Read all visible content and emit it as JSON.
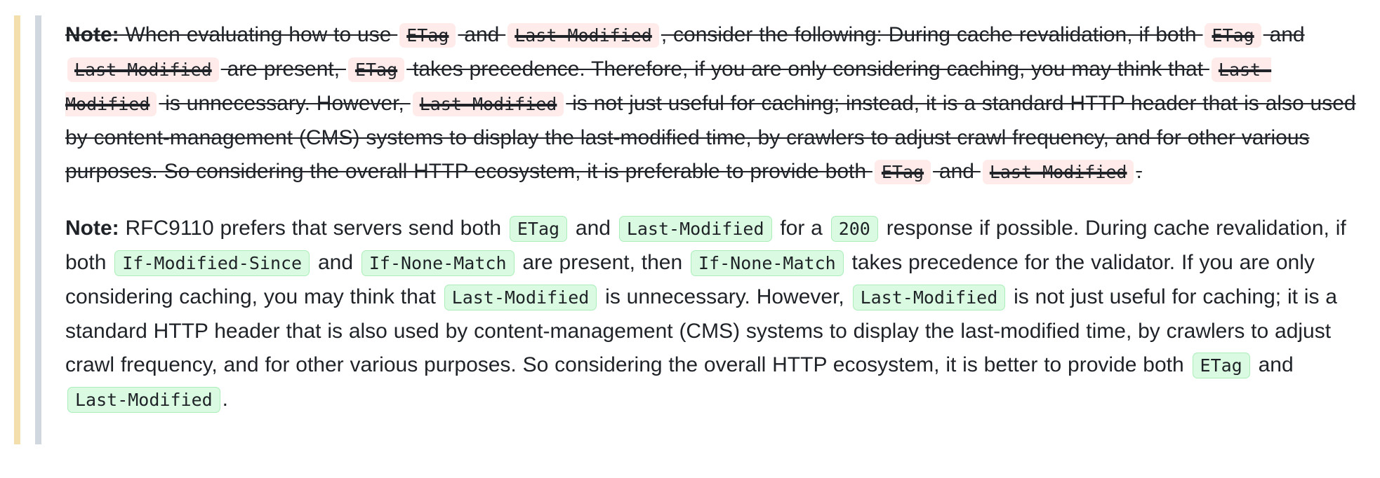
{
  "diff": {
    "removed": {
      "label": "Note:",
      "text": [
        " When evaluating how to use ",
        " and ",
        ", consider the following: During cache revalidation, if both ",
        " and ",
        " are present, ",
        " takes precedence. Therefore, if you are only considering caching, you may think that ",
        " is unnecessary. However, ",
        " is not just useful for caching; instead, it is a standard HTTP header that is also used by content-management (CMS) systems to display the last-modified time, by crawlers to adjust crawl frequency, and for other various purposes. So considering the overall HTTP ecosystem, it is preferable to provide both ",
        " and ",
        "."
      ],
      "code": [
        "ETag",
        "Last-Modified",
        "ETag",
        "Last-Modified",
        "ETag",
        "Last-Modified",
        "Last-Modified",
        "ETag",
        "Last-Modified"
      ]
    },
    "added": {
      "label": "Note:",
      "text": [
        " RFC9110 prefers that servers send both ",
        " and ",
        " for a ",
        " response if possible. During cache revalidation, if both ",
        " and ",
        " are present, then ",
        " takes precedence for the validator. If you are only considering caching, you may think that ",
        " is unnecessary. However, ",
        " is not just useful for caching; it is a standard HTTP header that is also used by content-management (CMS) systems to display the last-modified time, by crawlers to adjust crawl frequency, and for other various purposes. So considering the overall HTTP ecosystem, it is better to provide both ",
        " and ",
        "."
      ],
      "code": [
        "ETag",
        "Last-Modified",
        "200",
        "If-Modified-Since",
        "If-None-Match",
        "If-None-Match",
        "Last-Modified",
        "Last-Modified",
        "ETag",
        "Last-Modified"
      ]
    }
  }
}
